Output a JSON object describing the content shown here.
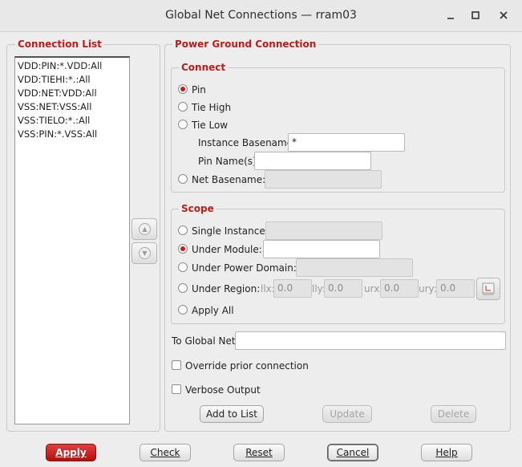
{
  "window": {
    "title": "Global Net Connections — rram03",
    "minimize_glyph": "✕",
    "maximize_glyph": "□",
    "close_glyph": "✕"
  },
  "connection_list": {
    "title": "Connection List",
    "items": [
      "VDD:PIN:*.VDD:All",
      "VDD:TIEHI:*.:All",
      "VDD:NET:VDD:All",
      "VSS:NET:VSS:All",
      "VSS:TIELO:*.:All",
      "VSS:PIN:*.VSS:All"
    ],
    "move_up_icon": "arrow-up-icon",
    "move_down_icon": "arrow-down-icon"
  },
  "power_ground": {
    "title": "Power Ground Connection",
    "connect": {
      "title": "Connect",
      "options": [
        "Pin",
        "Tie High",
        "Tie Low"
      ],
      "selected": "Pin",
      "instance_basename_label": "Instance Basename:",
      "instance_basename_value": "*",
      "pin_names_label": "Pin Name(s):",
      "pin_names_value": "",
      "net_basename_label": "Net Basename:",
      "net_basename_value": ""
    },
    "scope": {
      "title": "Scope",
      "single_instance_label": "Single Instance:",
      "under_module_label": "Under Module:",
      "under_module_value": "",
      "under_power_domain_label": "Under Power Domain:",
      "under_region_label": "Under Region:",
      "llx_label": "llx:",
      "llx_value": "0.0",
      "lly_label": "lly:",
      "lly_value": "0.0",
      "urx_label": "urx:",
      "urx_value": "0.0",
      "ury_label": "ury:",
      "ury_value": "0.0",
      "apply_all_label": "Apply All",
      "selected": "Under Module",
      "region_select_icon": "region-select-icon"
    },
    "to_global_net_label": "To Global Net:",
    "to_global_net_value": "",
    "override_label": "Override prior connection",
    "verbose_label": "Verbose Output",
    "add_to_list_label": "Add to List",
    "update_label": "Update",
    "delete_label": "Delete"
  },
  "footer": {
    "apply_label": "Apply",
    "check_label": "Check",
    "reset_label": "Reset",
    "cancel_label": "Cancel",
    "help_label": "Help"
  },
  "colors": {
    "accent": "#c41a1a",
    "primary_button": "#c41a1a"
  }
}
